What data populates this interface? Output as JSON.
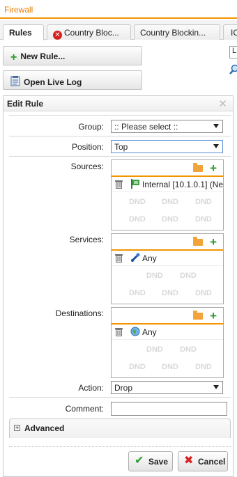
{
  "window": {
    "title": "Firewall"
  },
  "tabs": [
    {
      "label": "Rules",
      "active": true,
      "error": false
    },
    {
      "label": "Country Bloc...",
      "active": false,
      "error": true
    },
    {
      "label": "Country Blockin...",
      "active": false,
      "error": false
    },
    {
      "label": "IC",
      "active": false,
      "error": false
    }
  ],
  "toolbar": {
    "new_rule_label": "New Rule...",
    "live_log_label": "Open Live Log"
  },
  "right_stub": {
    "input_char": "L"
  },
  "dialog": {
    "title": "Edit Rule",
    "group": {
      "label": "Group:",
      "value": ":: Please select ::"
    },
    "position": {
      "label": "Position:",
      "value": "Top"
    },
    "sources": {
      "label": "Sources:",
      "items": [
        {
          "text": "Internal [10.1.0.1] (Ne"
        }
      ]
    },
    "services": {
      "label": "Services:",
      "items": [
        {
          "text": "Any"
        }
      ]
    },
    "destinations": {
      "label": "Destinations:",
      "items": [
        {
          "text": "Any"
        }
      ]
    },
    "dnd_label": "DND",
    "action": {
      "label": "Action:",
      "value": "Drop"
    },
    "comment": {
      "label": "Comment:",
      "value": ""
    },
    "advanced_label": "Advanced",
    "advanced_expander": "+",
    "close_glyph": "✕",
    "save_label": "Save",
    "cancel_label": "Cancel"
  },
  "colors": {
    "accent": "#f29400",
    "title_text": "#e87d00",
    "add_green": "#2e9a2e",
    "error_red": "#d62020"
  }
}
